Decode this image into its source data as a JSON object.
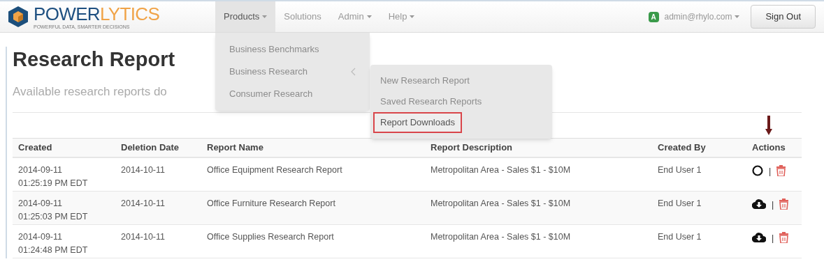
{
  "brand": {
    "name_primary": "POWER",
    "name_accent": "LYTICS",
    "tagline": "POWERFUL DATA, SMARTER DECISIONS"
  },
  "nav": [
    {
      "label": "Products",
      "dropdown": true,
      "selected": true
    },
    {
      "label": "Solutions",
      "dropdown": false,
      "selected": false
    },
    {
      "label": "Admin",
      "dropdown": true,
      "selected": false
    },
    {
      "label": "Help",
      "dropdown": true,
      "selected": false
    }
  ],
  "user": {
    "badge": "A",
    "email": "admin@rhylo.com"
  },
  "sign_out": "Sign Out",
  "page": {
    "title": "Research Report",
    "subtitle": "Available research reports do"
  },
  "products_menu": [
    {
      "label": "Business Benchmarks",
      "submenu": false
    },
    {
      "label": "Business Research",
      "submenu": true
    },
    {
      "label": "Consumer Research",
      "submenu": false
    }
  ],
  "submenu": [
    {
      "label": "New Research Report",
      "selected": false
    },
    {
      "label": "Saved Research Reports",
      "selected": false
    },
    {
      "label": "Report Downloads",
      "selected": true
    }
  ],
  "table": {
    "columns": [
      "Created",
      "Deletion Date",
      "Report Name",
      "Report Description",
      "Created By",
      "Actions"
    ],
    "rows": [
      {
        "created": [
          "2014-09-11",
          "01:25:19 PM EDT"
        ],
        "deletion": "2014-10-11",
        "name": "Office Equipment Research Report",
        "description": "Metropolitan Area - Sales $1 - $10M",
        "created_by": "End User 1",
        "kind": "pending",
        "separator": "|"
      },
      {
        "created": [
          "2014-09-11",
          "01:25:03 PM EDT"
        ],
        "deletion": "2014-10-11",
        "name": "Office Furniture Research Report",
        "description": "Metropolitan Area - Sales $1 - $10M",
        "created_by": "End User 1",
        "kind": "download",
        "separator": "|"
      },
      {
        "created": [
          "2014-09-11",
          "01:24:48 PM EDT"
        ],
        "deletion": "2014-10-11",
        "name": "Office Supplies Research Report",
        "description": "Metropolitan Area - Sales $1 - $10M",
        "created_by": "End User 1",
        "kind": "download",
        "separator": "|"
      }
    ]
  }
}
